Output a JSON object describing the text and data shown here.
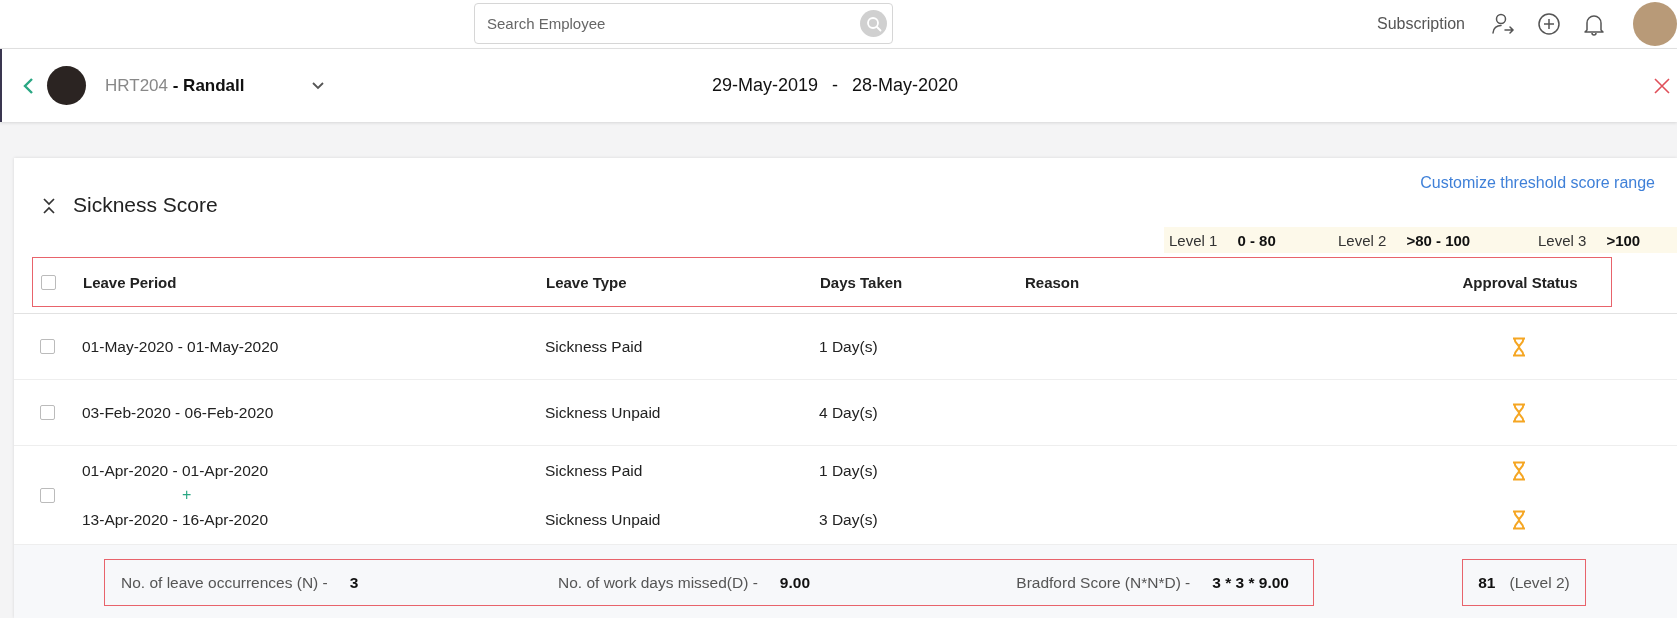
{
  "top_bar": {
    "search": {
      "placeholder": "Search Employee"
    },
    "subscription": "Subscription"
  },
  "employee_bar": {
    "employee_id": "HRT204",
    "employee_name": "- Randall",
    "period_start": "29-May-2019",
    "period_separator": "-",
    "period_end": "28-May-2020"
  },
  "card": {
    "title": "Sickness Score",
    "link": "Customize threshold score range",
    "levels": [
      {
        "label": "Level 1",
        "range": "0 - 80"
      },
      {
        "label": "Level 2",
        "range": ">80 - 100"
      },
      {
        "label": "Level 3",
        "range": ">100"
      }
    ]
  },
  "table": {
    "header": {
      "highlighted": true,
      "checked": false
    },
    "columns": [
      "Leave Period",
      "Leave Type",
      "Days Taken",
      "Reason",
      "Approval Status"
    ],
    "rows": [
      {
        "checked": false,
        "leaves": [
          {
            "period": "01-May-2020 - 01-May-2020",
            "type": "Sickness Paid",
            "days": "1 Day(s)",
            "kind": "pending"
          }
        ]
      },
      {
        "checked": false,
        "leaves": [
          {
            "period": "03-Feb-2020 - 06-Feb-2020",
            "type": "Sickness Unpaid",
            "days": "4 Day(s)",
            "kind": "pending"
          }
        ]
      },
      {
        "checked": false,
        "joiner": "+",
        "leaves": [
          {
            "period": "01-Apr-2020 - 01-Apr-2020",
            "type": "Sickness Paid",
            "days": "1 Day(s)",
            "kind": "pending"
          },
          {
            "period": "13-Apr-2020 - 16-Apr-2020",
            "type": "Sickness Unpaid",
            "days": "3 Day(s)",
            "kind": "pending"
          }
        ]
      }
    ]
  },
  "summary": {
    "formula": {
      "highlighted": true,
      "items": [
        {
          "label": "No. of leave occurrences (N) -",
          "value": "3"
        },
        {
          "label": "No. of work days missed(D) -",
          "value": "9.00"
        },
        {
          "label": "Bradford Score (N*N*D) -",
          "value": "3 * 3 * 9.00"
        }
      ]
    },
    "result": {
      "highlighted": true,
      "score": "81",
      "level": "(Level 2)"
    }
  }
}
